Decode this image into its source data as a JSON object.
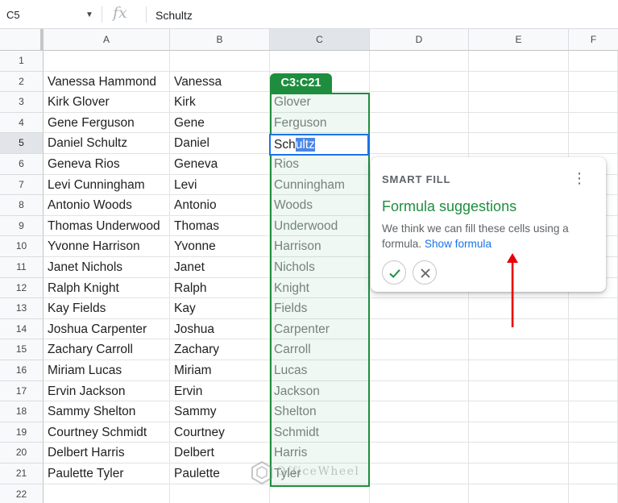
{
  "formula_bar": {
    "name_box": "C5",
    "fx_glyph": "fx",
    "value": "Schultz"
  },
  "columns": [
    "A",
    "B",
    "C",
    "D",
    "E",
    "F"
  ],
  "rows": [
    "1",
    "2",
    "3",
    "4",
    "5",
    "6",
    "7",
    "8",
    "9",
    "10",
    "11",
    "12",
    "13",
    "14",
    "15",
    "16",
    "17",
    "18",
    "19",
    "20",
    "21",
    "22"
  ],
  "data_rows": [
    {
      "full_name": "Vanessa Hammond",
      "first_name": "Vanessa",
      "suggestion": ""
    },
    {
      "full_name": "Kirk Glover",
      "first_name": "Kirk",
      "suggestion": "Glover"
    },
    {
      "full_name": "Gene Ferguson",
      "first_name": "Gene",
      "suggestion": "Ferguson"
    },
    {
      "full_name": "Daniel Schultz",
      "first_name": "Daniel",
      "suggestion": ""
    },
    {
      "full_name": "Geneva Rios",
      "first_name": "Geneva",
      "suggestion": "Rios"
    },
    {
      "full_name": "Levi Cunningham",
      "first_name": "Levi",
      "suggestion": "Cunningham"
    },
    {
      "full_name": "Antonio Woods",
      "first_name": "Antonio",
      "suggestion": "Woods"
    },
    {
      "full_name": "Thomas Underwood",
      "first_name": "Thomas",
      "suggestion": "Underwood"
    },
    {
      "full_name": "Yvonne Harrison",
      "first_name": "Yvonne",
      "suggestion": "Harrison"
    },
    {
      "full_name": "Janet Nichols",
      "first_name": "Janet",
      "suggestion": "Nichols"
    },
    {
      "full_name": "Ralph Knight",
      "first_name": "Ralph",
      "suggestion": "Knight"
    },
    {
      "full_name": "Kay Fields",
      "first_name": "Kay",
      "suggestion": "Fields"
    },
    {
      "full_name": "Joshua Carpenter",
      "first_name": "Joshua",
      "suggestion": "Carpenter"
    },
    {
      "full_name": "Zachary Carroll",
      "first_name": "Zachary",
      "suggestion": "Carroll"
    },
    {
      "full_name": "Miriam Lucas",
      "first_name": "Miriam",
      "suggestion": "Lucas"
    },
    {
      "full_name": "Ervin Jackson",
      "first_name": "Ervin",
      "suggestion": "Jackson"
    },
    {
      "full_name": "Sammy Shelton",
      "first_name": "Sammy",
      "suggestion": "Shelton"
    },
    {
      "full_name": "Courtney Schmidt",
      "first_name": "Courtney",
      "suggestion": "Schmidt"
    },
    {
      "full_name": "Delbert Harris",
      "first_name": "Delbert",
      "suggestion": "Harris"
    },
    {
      "full_name": "Paulette Tyler",
      "first_name": "Paulette",
      "suggestion": "Tyler"
    }
  ],
  "selection": {
    "range_label": "C3:C21",
    "active_cell_typed": "Sch",
    "active_cell_autocomplete": "ultz",
    "accent_color": "#1e8e3e",
    "active_border_color": "#1a73e8"
  },
  "smart_fill": {
    "label": "SMART FILL",
    "title": "Formula suggestions",
    "body": "We think we can fill these cells using a formula.",
    "link": "Show formula",
    "more_icon": "more-vertical-icon",
    "accept_icon": "check-icon",
    "reject_icon": "close-icon"
  },
  "annotation": {
    "icon": "red-arrow-up",
    "color": "#e8000b"
  },
  "watermark": {
    "text": "OfficeWheel",
    "icon": "officewheel-logo"
  }
}
